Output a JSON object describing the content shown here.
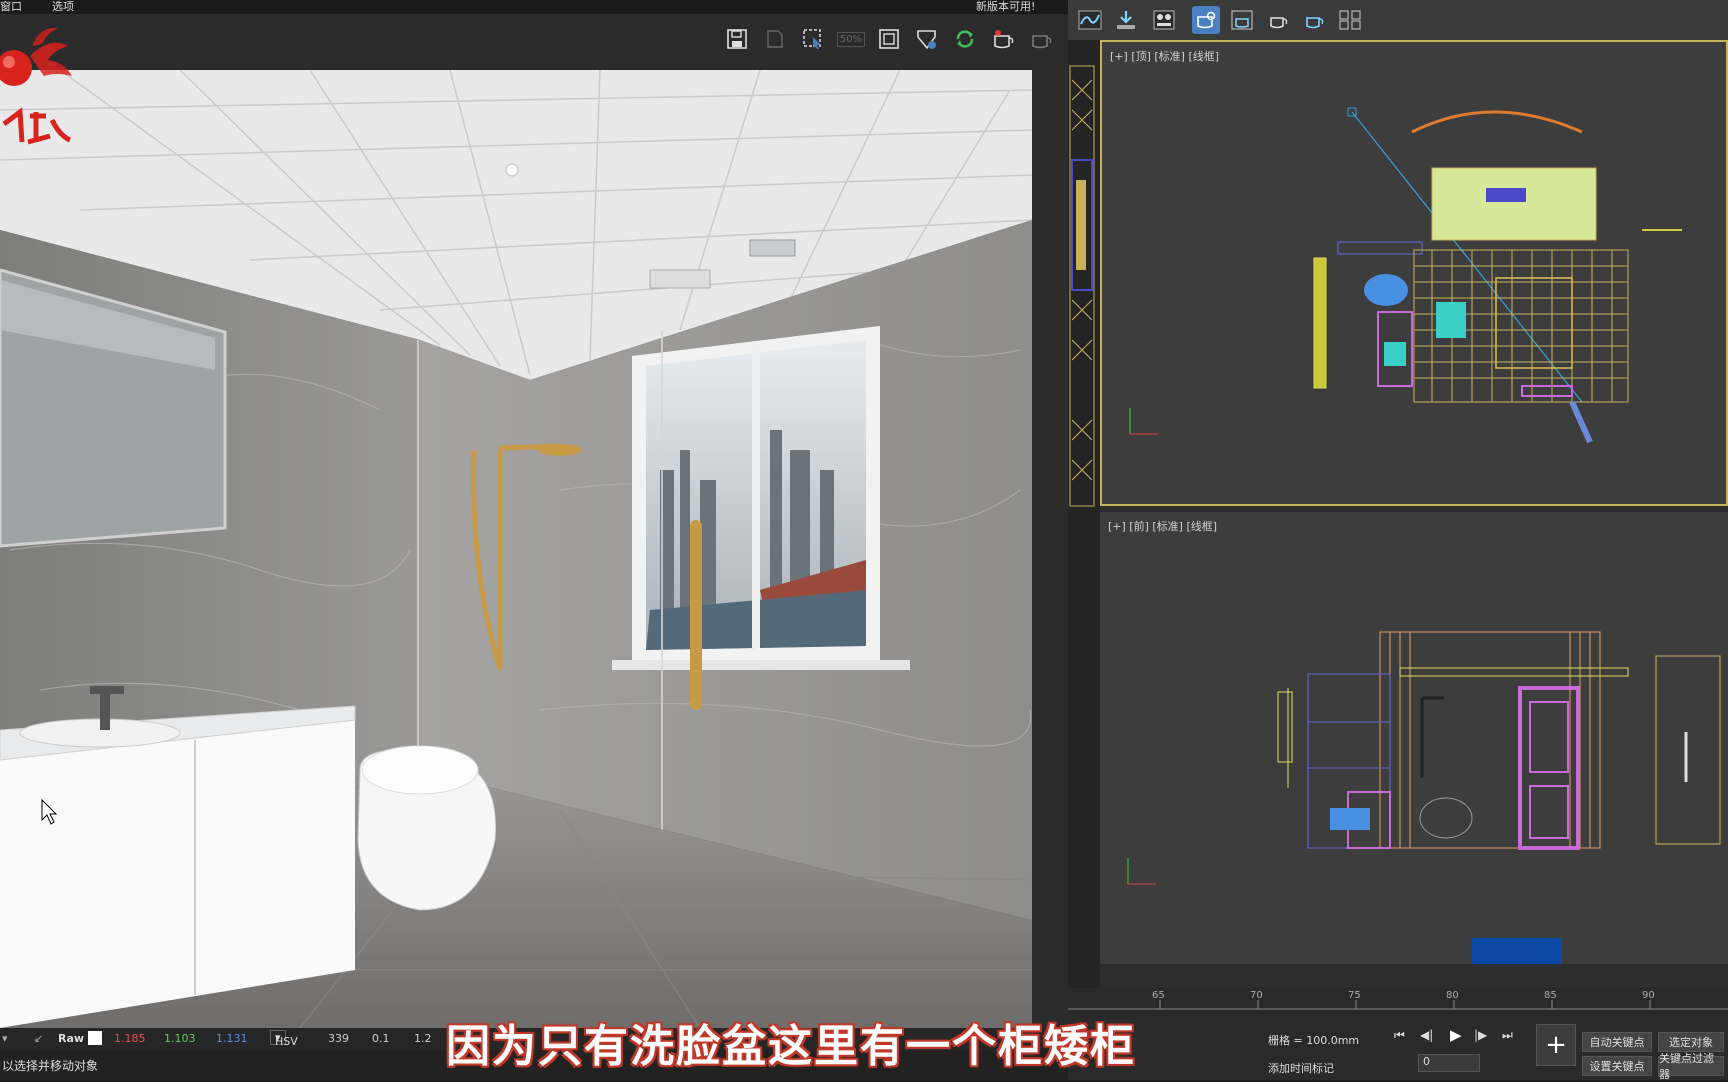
{
  "menu": {
    "window_label": "窗口",
    "options_label": "选项",
    "update_notice": "新版本可用!"
  },
  "vfb": {
    "toolbar_icons": [
      "save-icon",
      "clear-icon",
      "region-select-icon",
      "zoom-50-icon",
      "frame-icon",
      "lens-icon",
      "refresh-icon",
      "teapot-render-icon",
      "teapot-icon"
    ],
    "zoom_label": "50%",
    "status": {
      "mode": "Raw",
      "r": "1.185",
      "g": "1.103",
      "b": "1.131",
      "colorspace": "HSV",
      "v1": "339",
      "v2": "0.1",
      "v3": "1.2"
    },
    "hint_text": "以选择并移动对象"
  },
  "max": {
    "toolbar_icons": [
      "curve-editor-icon",
      "import-icon",
      "material-editor-icon",
      "render-setup-icon",
      "render-frame-icon",
      "render-teapot-icon",
      "active-shade-icon",
      "schematic-icon"
    ],
    "viewport_top": {
      "label": "[+] [顶] [标准] [线框]"
    },
    "viewport_front": {
      "label": "[+] [前] [标准] [线框]"
    },
    "timeline_ticks": [
      "65",
      "70",
      "75",
      "80",
      "85",
      "90"
    ],
    "grid_text": "栅格 = 100.0mm",
    "add_time_tag": "添加时间标记",
    "frame_value": "0",
    "auto_key": "自动关键点",
    "set_key": "设置关键点",
    "selected": "选定对象",
    "key_filter": "关键点过滤器"
  },
  "subtitle": "因为只有洗脸盆这里有一个柜矮柜",
  "colors": {
    "accent_yellow": "#c9b15a",
    "active_blue": "#4a7fc1",
    "subtitle_outline": "#c0392b"
  }
}
